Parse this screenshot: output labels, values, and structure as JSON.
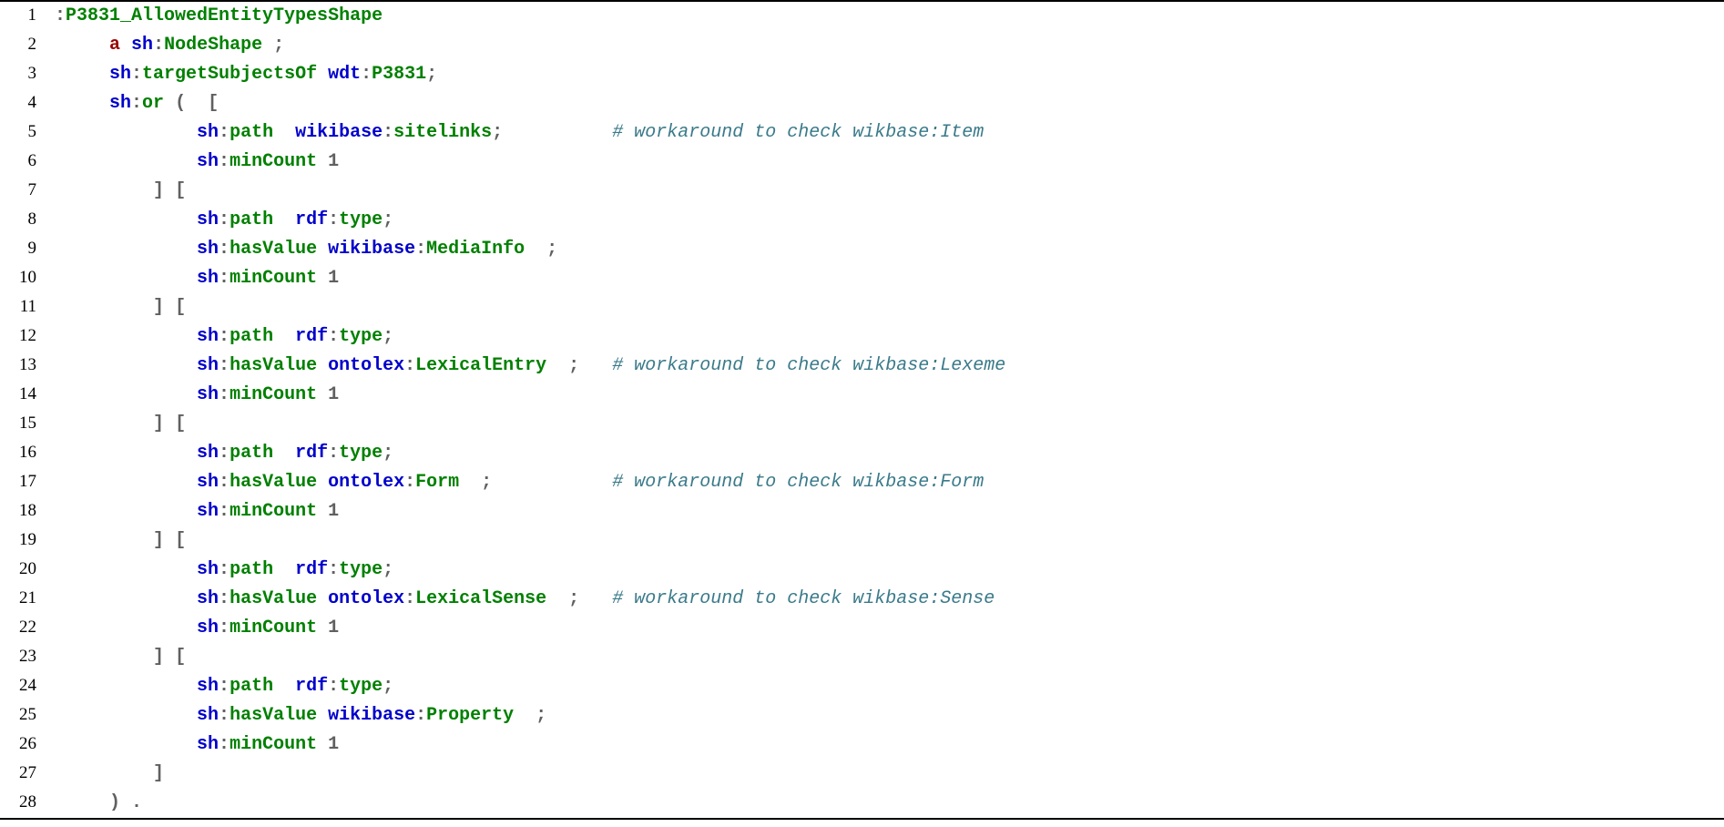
{
  "lines": [
    {
      "n": "1",
      "segs": [
        {
          "c": "punct",
          "t": ":"
        },
        {
          "c": "local",
          "t": "P3831_AllowedEntityTypesShape"
        }
      ]
    },
    {
      "n": "2",
      "segs": [
        {
          "c": "",
          "t": "     "
        },
        {
          "c": "kw",
          "t": "a"
        },
        {
          "c": "",
          "t": " "
        },
        {
          "c": "prefix",
          "t": "sh"
        },
        {
          "c": "punct",
          "t": ":"
        },
        {
          "c": "local",
          "t": "NodeShape"
        },
        {
          "c": "",
          "t": " "
        },
        {
          "c": "punct",
          "t": ";"
        }
      ]
    },
    {
      "n": "3",
      "segs": [
        {
          "c": "",
          "t": "     "
        },
        {
          "c": "prefix",
          "t": "sh"
        },
        {
          "c": "punct",
          "t": ":"
        },
        {
          "c": "local",
          "t": "targetSubjectsOf"
        },
        {
          "c": "",
          "t": " "
        },
        {
          "c": "prefix",
          "t": "wdt"
        },
        {
          "c": "punct",
          "t": ":"
        },
        {
          "c": "local",
          "t": "P3831"
        },
        {
          "c": "punct",
          "t": ";"
        }
      ]
    },
    {
      "n": "4",
      "segs": [
        {
          "c": "",
          "t": "     "
        },
        {
          "c": "prefix",
          "t": "sh"
        },
        {
          "c": "punct",
          "t": ":"
        },
        {
          "c": "local",
          "t": "or"
        },
        {
          "c": "",
          "t": " "
        },
        {
          "c": "punct",
          "t": "("
        },
        {
          "c": "",
          "t": "  "
        },
        {
          "c": "punct",
          "t": "["
        }
      ]
    },
    {
      "n": "5",
      "segs": [
        {
          "c": "",
          "t": "             "
        },
        {
          "c": "prefix",
          "t": "sh"
        },
        {
          "c": "punct",
          "t": ":"
        },
        {
          "c": "local",
          "t": "path"
        },
        {
          "c": "",
          "t": "  "
        },
        {
          "c": "prefix",
          "t": "wikibase"
        },
        {
          "c": "punct",
          "t": ":"
        },
        {
          "c": "local",
          "t": "sitelinks"
        },
        {
          "c": "punct",
          "t": ";"
        },
        {
          "c": "",
          "t": "          "
        },
        {
          "c": "comment",
          "t": "# workaround to check wikbase:Item"
        }
      ]
    },
    {
      "n": "6",
      "segs": [
        {
          "c": "",
          "t": "             "
        },
        {
          "c": "prefix",
          "t": "sh"
        },
        {
          "c": "punct",
          "t": ":"
        },
        {
          "c": "local",
          "t": "minCount"
        },
        {
          "c": "",
          "t": " "
        },
        {
          "c": "num",
          "t": "1"
        }
      ]
    },
    {
      "n": "7",
      "segs": [
        {
          "c": "",
          "t": "         "
        },
        {
          "c": "punct",
          "t": "]"
        },
        {
          "c": "",
          "t": " "
        },
        {
          "c": "punct",
          "t": "["
        }
      ]
    },
    {
      "n": "8",
      "segs": [
        {
          "c": "",
          "t": "             "
        },
        {
          "c": "prefix",
          "t": "sh"
        },
        {
          "c": "punct",
          "t": ":"
        },
        {
          "c": "local",
          "t": "path"
        },
        {
          "c": "",
          "t": "  "
        },
        {
          "c": "prefix",
          "t": "rdf"
        },
        {
          "c": "punct",
          "t": ":"
        },
        {
          "c": "local",
          "t": "type"
        },
        {
          "c": "punct",
          "t": ";"
        }
      ]
    },
    {
      "n": "9",
      "segs": [
        {
          "c": "",
          "t": "             "
        },
        {
          "c": "prefix",
          "t": "sh"
        },
        {
          "c": "punct",
          "t": ":"
        },
        {
          "c": "local",
          "t": "hasValue"
        },
        {
          "c": "",
          "t": " "
        },
        {
          "c": "prefix",
          "t": "wikibase"
        },
        {
          "c": "punct",
          "t": ":"
        },
        {
          "c": "local",
          "t": "MediaInfo"
        },
        {
          "c": "",
          "t": "  "
        },
        {
          "c": "punct",
          "t": ";"
        }
      ]
    },
    {
      "n": "10",
      "segs": [
        {
          "c": "",
          "t": "             "
        },
        {
          "c": "prefix",
          "t": "sh"
        },
        {
          "c": "punct",
          "t": ":"
        },
        {
          "c": "local",
          "t": "minCount"
        },
        {
          "c": "",
          "t": " "
        },
        {
          "c": "num",
          "t": "1"
        }
      ]
    },
    {
      "n": "11",
      "segs": [
        {
          "c": "",
          "t": "         "
        },
        {
          "c": "punct",
          "t": "]"
        },
        {
          "c": "",
          "t": " "
        },
        {
          "c": "punct",
          "t": "["
        }
      ]
    },
    {
      "n": "12",
      "segs": [
        {
          "c": "",
          "t": "             "
        },
        {
          "c": "prefix",
          "t": "sh"
        },
        {
          "c": "punct",
          "t": ":"
        },
        {
          "c": "local",
          "t": "path"
        },
        {
          "c": "",
          "t": "  "
        },
        {
          "c": "prefix",
          "t": "rdf"
        },
        {
          "c": "punct",
          "t": ":"
        },
        {
          "c": "local",
          "t": "type"
        },
        {
          "c": "punct",
          "t": ";"
        }
      ]
    },
    {
      "n": "13",
      "segs": [
        {
          "c": "",
          "t": "             "
        },
        {
          "c": "prefix",
          "t": "sh"
        },
        {
          "c": "punct",
          "t": ":"
        },
        {
          "c": "local",
          "t": "hasValue"
        },
        {
          "c": "",
          "t": " "
        },
        {
          "c": "prefix",
          "t": "ontolex"
        },
        {
          "c": "punct",
          "t": ":"
        },
        {
          "c": "local",
          "t": "LexicalEntry"
        },
        {
          "c": "",
          "t": "  "
        },
        {
          "c": "punct",
          "t": ";"
        },
        {
          "c": "",
          "t": "   "
        },
        {
          "c": "comment",
          "t": "# workaround to check wikbase:Lexeme"
        }
      ]
    },
    {
      "n": "14",
      "segs": [
        {
          "c": "",
          "t": "             "
        },
        {
          "c": "prefix",
          "t": "sh"
        },
        {
          "c": "punct",
          "t": ":"
        },
        {
          "c": "local",
          "t": "minCount"
        },
        {
          "c": "",
          "t": " "
        },
        {
          "c": "num",
          "t": "1"
        }
      ]
    },
    {
      "n": "15",
      "segs": [
        {
          "c": "",
          "t": "         "
        },
        {
          "c": "punct",
          "t": "]"
        },
        {
          "c": "",
          "t": " "
        },
        {
          "c": "punct",
          "t": "["
        }
      ]
    },
    {
      "n": "16",
      "segs": [
        {
          "c": "",
          "t": "             "
        },
        {
          "c": "prefix",
          "t": "sh"
        },
        {
          "c": "punct",
          "t": ":"
        },
        {
          "c": "local",
          "t": "path"
        },
        {
          "c": "",
          "t": "  "
        },
        {
          "c": "prefix",
          "t": "rdf"
        },
        {
          "c": "punct",
          "t": ":"
        },
        {
          "c": "local",
          "t": "type"
        },
        {
          "c": "punct",
          "t": ";"
        }
      ]
    },
    {
      "n": "17",
      "segs": [
        {
          "c": "",
          "t": "             "
        },
        {
          "c": "prefix",
          "t": "sh"
        },
        {
          "c": "punct",
          "t": ":"
        },
        {
          "c": "local",
          "t": "hasValue"
        },
        {
          "c": "",
          "t": " "
        },
        {
          "c": "prefix",
          "t": "ontolex"
        },
        {
          "c": "punct",
          "t": ":"
        },
        {
          "c": "local",
          "t": "Form"
        },
        {
          "c": "",
          "t": "  "
        },
        {
          "c": "punct",
          "t": ";"
        },
        {
          "c": "",
          "t": "           "
        },
        {
          "c": "comment",
          "t": "# workaround to check wikbase:Form"
        }
      ]
    },
    {
      "n": "18",
      "segs": [
        {
          "c": "",
          "t": "             "
        },
        {
          "c": "prefix",
          "t": "sh"
        },
        {
          "c": "punct",
          "t": ":"
        },
        {
          "c": "local",
          "t": "minCount"
        },
        {
          "c": "",
          "t": " "
        },
        {
          "c": "num",
          "t": "1"
        }
      ]
    },
    {
      "n": "19",
      "segs": [
        {
          "c": "",
          "t": "         "
        },
        {
          "c": "punct",
          "t": "]"
        },
        {
          "c": "",
          "t": " "
        },
        {
          "c": "punct",
          "t": "["
        }
      ]
    },
    {
      "n": "20",
      "segs": [
        {
          "c": "",
          "t": "             "
        },
        {
          "c": "prefix",
          "t": "sh"
        },
        {
          "c": "punct",
          "t": ":"
        },
        {
          "c": "local",
          "t": "path"
        },
        {
          "c": "",
          "t": "  "
        },
        {
          "c": "prefix",
          "t": "rdf"
        },
        {
          "c": "punct",
          "t": ":"
        },
        {
          "c": "local",
          "t": "type"
        },
        {
          "c": "punct",
          "t": ";"
        }
      ]
    },
    {
      "n": "21",
      "segs": [
        {
          "c": "",
          "t": "             "
        },
        {
          "c": "prefix",
          "t": "sh"
        },
        {
          "c": "punct",
          "t": ":"
        },
        {
          "c": "local",
          "t": "hasValue"
        },
        {
          "c": "",
          "t": " "
        },
        {
          "c": "prefix",
          "t": "ontolex"
        },
        {
          "c": "punct",
          "t": ":"
        },
        {
          "c": "local",
          "t": "LexicalSense"
        },
        {
          "c": "",
          "t": "  "
        },
        {
          "c": "punct",
          "t": ";"
        },
        {
          "c": "",
          "t": "   "
        },
        {
          "c": "comment",
          "t": "# workaround to check wikbase:Sense"
        }
      ]
    },
    {
      "n": "22",
      "segs": [
        {
          "c": "",
          "t": "             "
        },
        {
          "c": "prefix",
          "t": "sh"
        },
        {
          "c": "punct",
          "t": ":"
        },
        {
          "c": "local",
          "t": "minCount"
        },
        {
          "c": "",
          "t": " "
        },
        {
          "c": "num",
          "t": "1"
        }
      ]
    },
    {
      "n": "23",
      "segs": [
        {
          "c": "",
          "t": "         "
        },
        {
          "c": "punct",
          "t": "]"
        },
        {
          "c": "",
          "t": " "
        },
        {
          "c": "punct",
          "t": "["
        }
      ]
    },
    {
      "n": "24",
      "segs": [
        {
          "c": "",
          "t": "             "
        },
        {
          "c": "prefix",
          "t": "sh"
        },
        {
          "c": "punct",
          "t": ":"
        },
        {
          "c": "local",
          "t": "path"
        },
        {
          "c": "",
          "t": "  "
        },
        {
          "c": "prefix",
          "t": "rdf"
        },
        {
          "c": "punct",
          "t": ":"
        },
        {
          "c": "local",
          "t": "type"
        },
        {
          "c": "punct",
          "t": ";"
        }
      ]
    },
    {
      "n": "25",
      "segs": [
        {
          "c": "",
          "t": "             "
        },
        {
          "c": "prefix",
          "t": "sh"
        },
        {
          "c": "punct",
          "t": ":"
        },
        {
          "c": "local",
          "t": "hasValue"
        },
        {
          "c": "",
          "t": " "
        },
        {
          "c": "prefix",
          "t": "wikibase"
        },
        {
          "c": "punct",
          "t": ":"
        },
        {
          "c": "local",
          "t": "Property"
        },
        {
          "c": "",
          "t": "  "
        },
        {
          "c": "punct",
          "t": ";"
        }
      ]
    },
    {
      "n": "26",
      "segs": [
        {
          "c": "",
          "t": "             "
        },
        {
          "c": "prefix",
          "t": "sh"
        },
        {
          "c": "punct",
          "t": ":"
        },
        {
          "c": "local",
          "t": "minCount"
        },
        {
          "c": "",
          "t": " "
        },
        {
          "c": "num",
          "t": "1"
        }
      ]
    },
    {
      "n": "27",
      "segs": [
        {
          "c": "",
          "t": "         "
        },
        {
          "c": "punct",
          "t": "]"
        }
      ]
    },
    {
      "n": "28",
      "segs": [
        {
          "c": "",
          "t": "     "
        },
        {
          "c": "punct",
          "t": ")"
        },
        {
          "c": "",
          "t": " "
        },
        {
          "c": "punct",
          "t": "."
        }
      ]
    }
  ]
}
